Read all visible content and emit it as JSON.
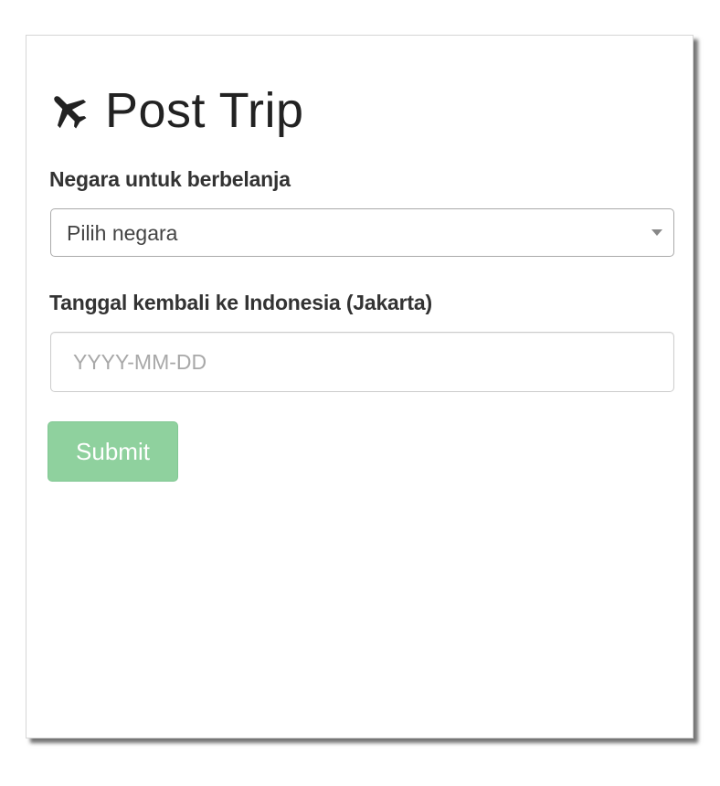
{
  "form": {
    "title": "Post Trip",
    "title_icon": "plane-icon",
    "country_label": "Negara untuk berbelanja",
    "country_select_value": "Pilih negara",
    "date_label": "Tanggal kembali ke Indonesia (Jakarta)",
    "date_placeholder": "YYYY-MM-DD",
    "date_value": "",
    "submit_label": "Submit"
  },
  "colors": {
    "submit_background": "#8fd19e",
    "text": "#333333"
  }
}
